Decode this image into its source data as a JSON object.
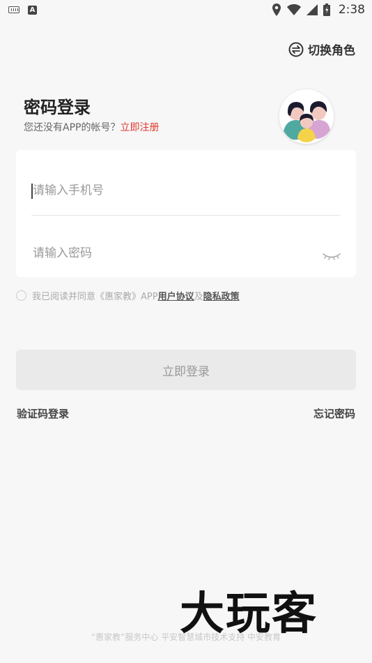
{
  "status_bar": {
    "time": "2:38"
  },
  "header": {
    "switch_role_label": "切换角色",
    "title": "密码登录",
    "subtitle_prefix": "您还没有APP的帐号？",
    "register_link": "立即注册"
  },
  "form": {
    "phone_placeholder": "请输入手机号",
    "password_placeholder": "请输入密码"
  },
  "agreement": {
    "prefix": "我已阅读并同意《惠家教》APP",
    "user_agreement": "用户协议",
    "and": "及",
    "privacy_policy": "隐私政策"
  },
  "actions": {
    "login_button": "立即登录",
    "code_login": "验证码登录",
    "forgot_password": "忘记密码"
  },
  "footer": {
    "text": "“惠家教”服务中心 平安智慧城市技术支持 中安教育",
    "watermark": "大玩客"
  },
  "colors": {
    "accent": "#e0382b",
    "background": "#f7f7f7",
    "button_disabled": "#eaeaea"
  }
}
